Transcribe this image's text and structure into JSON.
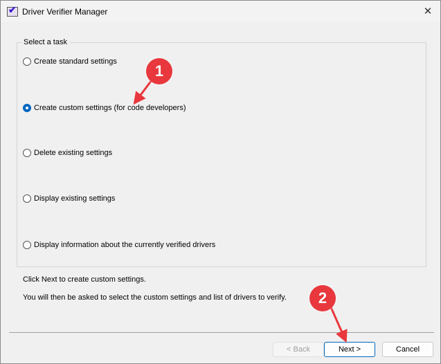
{
  "window": {
    "title": "Driver Verifier Manager",
    "close_label": "✕"
  },
  "group": {
    "label": "Select a task"
  },
  "options": [
    {
      "label": "Create standard settings",
      "checked": false
    },
    {
      "label": "Create custom settings (for code developers)",
      "checked": true
    },
    {
      "label": "Delete existing settings",
      "checked": false
    },
    {
      "label": "Display existing settings",
      "checked": false
    },
    {
      "label": "Display information about the currently verified drivers",
      "checked": false
    }
  ],
  "info": {
    "line1": "Click Next to create custom settings.",
    "line2": "You will then be asked to select the custom settings and list of drivers to verify."
  },
  "buttons": {
    "back": "< Back",
    "next": "Next >",
    "cancel": "Cancel"
  },
  "annotations": {
    "step1": "1",
    "step2": "2",
    "color": "#e8383d"
  }
}
